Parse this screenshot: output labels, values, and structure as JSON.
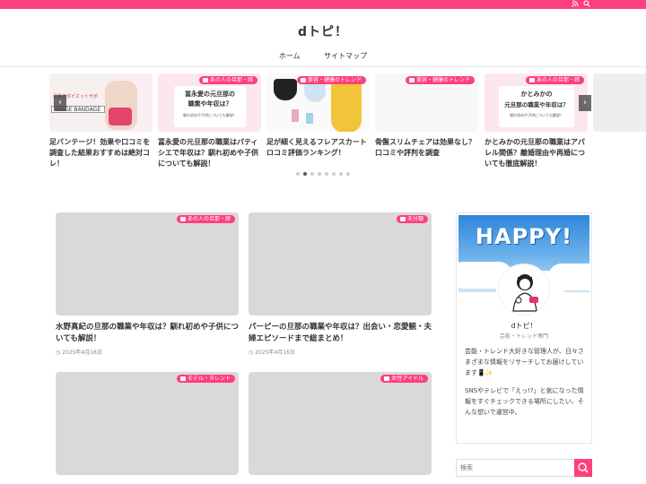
{
  "site": {
    "title": "dトピ！"
  },
  "topbar": {
    "icons": [
      "rss-icon",
      "search-icon"
    ],
    "accent": "#ff3f7b"
  },
  "nav": {
    "items": [
      "ホーム",
      "サイトマップ"
    ]
  },
  "carousel": {
    "slides": [
      {
        "title": "足バンテージ！効果や口コミを調査した結果おすすめは絶対コレ！",
        "category": "",
        "thumb_text": [
          "足長のダイエットサポ",
          "INAGE BANDAGE"
        ]
      },
      {
        "title": "冨永愛の元旦那の職業はパティシエで年収は？馴れ初めや子供についても解説！",
        "category": "あの人の旦那・嫁",
        "thumb_text": [
          "冨永愛の元旦那の",
          "職業や年収は？",
          "馴れ初めや子供についても解説！"
        ]
      },
      {
        "title": "足が細く見えるフレアスカートロコミ評価ランキング！",
        "category": "美容・健康のトレンド",
        "thumb_text": []
      },
      {
        "title": "骨盤スリムチェアは効果なし？口コミや評判を調査",
        "category": "美容・健康のトレンド",
        "thumb_text": []
      },
      {
        "title": "かとみかの元旦那の職業はアパレル関係？離婚理由や再婚についても徹底解説！",
        "category": "あの人の旦那・嫁",
        "thumb_text": [
          "かとみかの",
          "元旦那の職業や年収は？",
          "馴れ初めや子供についても解説！"
        ]
      }
    ],
    "dots": 8,
    "active_dot": 1
  },
  "posts": [
    {
      "title": "水野真紀の旦那の職業や年収は？馴れ初めや子供についても解説！",
      "category": "あの人の旦那・嫁",
      "date": "2025年4月16日"
    },
    {
      "title": "パーピーの旦那の職業や年収は？出会い・恋愛観・夫婦エピソードまで総まとめ！",
      "category": "未分類",
      "date": "2025年4月16日"
    },
    {
      "title": "",
      "category": "モデル・タレント",
      "date": ""
    },
    {
      "title": "",
      "category": "女性アイドル",
      "date": ""
    }
  ],
  "sidebar": {
    "banner_text": "HAPPY!",
    "name": "dトピ！",
    "subtitle": "芸能・トレンド専門",
    "bio": "芸能・トレンド大好きな管理人が、日々さまざまな情報をリサーチしてお届けしています📱✨",
    "bio2": "SNSやテレビで「えっ!?」と気になった情報をすぐチェックできる場所にしたい、そんな想いで運営中。",
    "search_placeholder": "検索"
  },
  "colors": {
    "accent": "#ff3f7b",
    "card_placeholder": "#d9d9d9"
  }
}
